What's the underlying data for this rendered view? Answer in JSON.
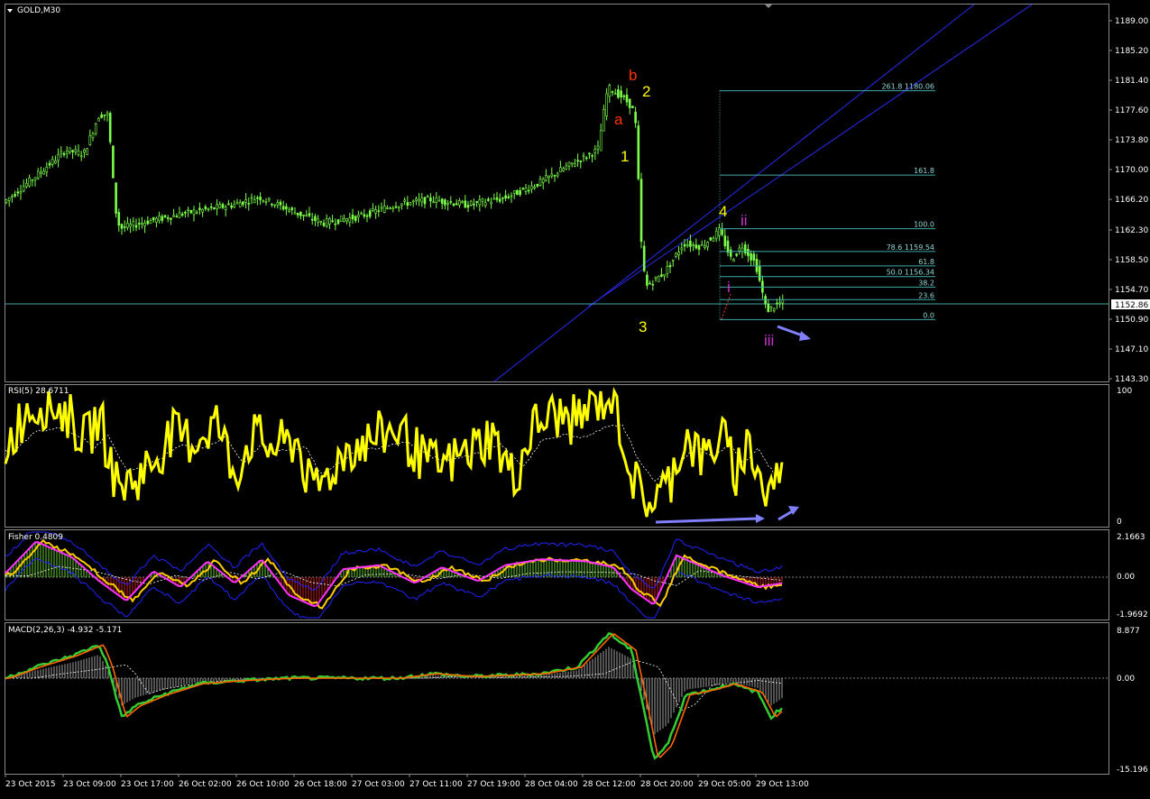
{
  "symbol": "GOLD,M30",
  "price_axis": [
    "1189.00",
    "1185.20",
    "1181.40",
    "1177.60",
    "1173.80",
    "1170.00",
    "1166.20",
    "1162.30",
    "1158.50",
    "1154.70",
    "1150.90",
    "1147.10",
    "1143.30"
  ],
  "current_price": "1152.86",
  "time_axis": [
    "23 Oct 2015",
    "23 Oct 09:00",
    "23 Oct 17:00",
    "26 Oct 02:00",
    "26 Oct 10:00",
    "26 Oct 18:00",
    "27 Oct 03:00",
    "27 Oct 11:00",
    "27 Oct 19:00",
    "28 Oct 04:00",
    "28 Oct 12:00",
    "28 Oct 20:00",
    "29 Oct 05:00",
    "29 Oct 13:00"
  ],
  "fib_levels": [
    {
      "label": "261.8  1180.06",
      "price": 1180.06
    },
    {
      "label": "161.8",
      "price": 1169.3
    },
    {
      "label": "100.0",
      "price": 1162.45
    },
    {
      "label": "78.6  1159.54",
      "price": 1159.54
    },
    {
      "label": "61.8",
      "price": 1157.7
    },
    {
      "label": "50.0  1156.34",
      "price": 1156.34
    },
    {
      "label": "38.2",
      "price": 1155.0
    },
    {
      "label": "23.6",
      "price": 1153.4
    },
    {
      "label": "0.0",
      "price": 1150.85
    }
  ],
  "wave_labels": [
    {
      "text": "b",
      "color": "#ff3300"
    },
    {
      "text": "a",
      "color": "#ff3300"
    },
    {
      "text": "2",
      "color": "#ffff00"
    },
    {
      "text": "1",
      "color": "#ffff00"
    },
    {
      "text": "3",
      "color": "#ffff00"
    },
    {
      "text": "4",
      "color": "#ffff00"
    },
    {
      "text": "ii",
      "color": "#cc33cc"
    },
    {
      "text": "i",
      "color": "#cc33cc"
    },
    {
      "text": "iii",
      "color": "#cc33cc"
    }
  ],
  "rsi": {
    "title": "RSI(5) 28.6711",
    "top": "100",
    "bottom": "0"
  },
  "fisher": {
    "title": "Fisher 0.4809",
    "top": "2.1663",
    "mid": "0.00",
    "bottom": "-1.9692"
  },
  "macd": {
    "title": "MACD(2,26,3) -4.932 -5.171",
    "top": "8.877",
    "mid": "0.00",
    "bottom": "-15.196"
  },
  "colors": {
    "candles": "#7cff4a",
    "rsi": "#ffff00",
    "fisher_main": "#ff33ff",
    "fisher_signal": "#ffcc00",
    "bands": "#2222ff",
    "macd_main": "#33cc33",
    "macd_signal": "#ff6600",
    "channel": "#2a2af0",
    "fib": "#3fa9a9",
    "arrow": "#8080ff"
  },
  "chart_data": [
    {
      "type": "line",
      "title": "GOLD,M30",
      "ylim": [
        1143.3,
        1189.0
      ],
      "x": [
        "23 Oct 2015",
        "23 Oct 09:00",
        "23 Oct 17:00",
        "26 Oct 02:00",
        "26 Oct 10:00",
        "26 Oct 18:00",
        "27 Oct 03:00",
        "27 Oct 11:00",
        "27 Oct 19:00",
        "28 Oct 04:00",
        "28 Oct 12:00",
        "28 Oct 20:00",
        "29 Oct 05:00",
        "29 Oct 13:00"
      ],
      "series": [
        {
          "name": "GOLD,M30",
          "values": [
            1165.8,
            1172.0,
            1162.5,
            1164.5,
            1166.2,
            1163.5,
            1164.8,
            1166.0,
            1166.5,
            1168.5,
            1178.0,
            1157.0,
            1161.0,
            1152.9
          ]
        }
      ]
    },
    {
      "type": "line",
      "title": "RSI(5) 28.6711",
      "ylim": [
        0,
        100
      ],
      "series": [
        {
          "name": "RSI(5)",
          "values": [
            60,
            85,
            30,
            55,
            50,
            25,
            60,
            45,
            55,
            70,
            95,
            10,
            65,
            29
          ]
        }
      ]
    },
    {
      "type": "line",
      "title": "Fisher 0.4809",
      "ylim": [
        -1.9692,
        2.1663
      ],
      "series": [
        {
          "name": "Fisher",
          "values": [
            0.2,
            1.8,
            -1.0,
            0.8,
            0.5,
            -1.5,
            0.6,
            0.2,
            0.4,
            0.9,
            0.6,
            -1.4,
            1.1,
            -0.3
          ]
        }
      ]
    },
    {
      "type": "line",
      "title": "MACD(2,26,3) -4.932 -5.171",
      "ylim": [
        -15.196,
        8.877
      ],
      "series": [
        {
          "name": "MACD",
          "values": [
            0,
            4,
            -3,
            -1,
            0,
            0,
            0,
            0,
            0,
            1,
            6,
            -14,
            -1,
            -5
          ]
        }
      ]
    }
  ]
}
